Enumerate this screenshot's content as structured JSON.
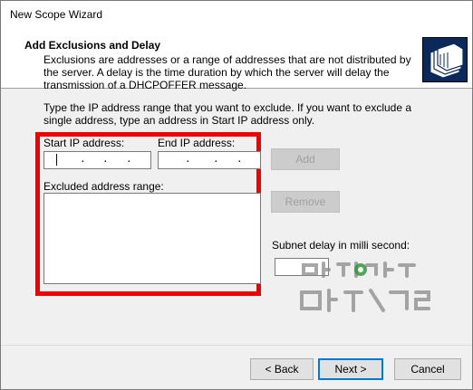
{
  "window": {
    "title": "New Scope Wizard"
  },
  "header": {
    "title": "Add Exclusions and Delay",
    "description": "Exclusions are addresses or a range of addresses that are not distributed by the server. A delay is the time duration by which the server will delay the transmission of a DHCPOFFER message."
  },
  "body": {
    "instructions": "Type the IP address range that you want to exclude. If you want to exclude a single address, type an address in Start IP address only.",
    "start_ip_label": "Start IP address:",
    "end_ip_label": "End IP address:",
    "excluded_range_label": "Excluded address range:",
    "add_label": "Add",
    "remove_label": "Remove",
    "subnet_delay_label": "Subnet delay in milli second:"
  },
  "footer": {
    "back_label": "< Back",
    "next_label": "Next >",
    "cancel_label": "Cancel"
  },
  "colors": {
    "highlight_box": "#f00000",
    "default_button_border": "#0078d7"
  }
}
